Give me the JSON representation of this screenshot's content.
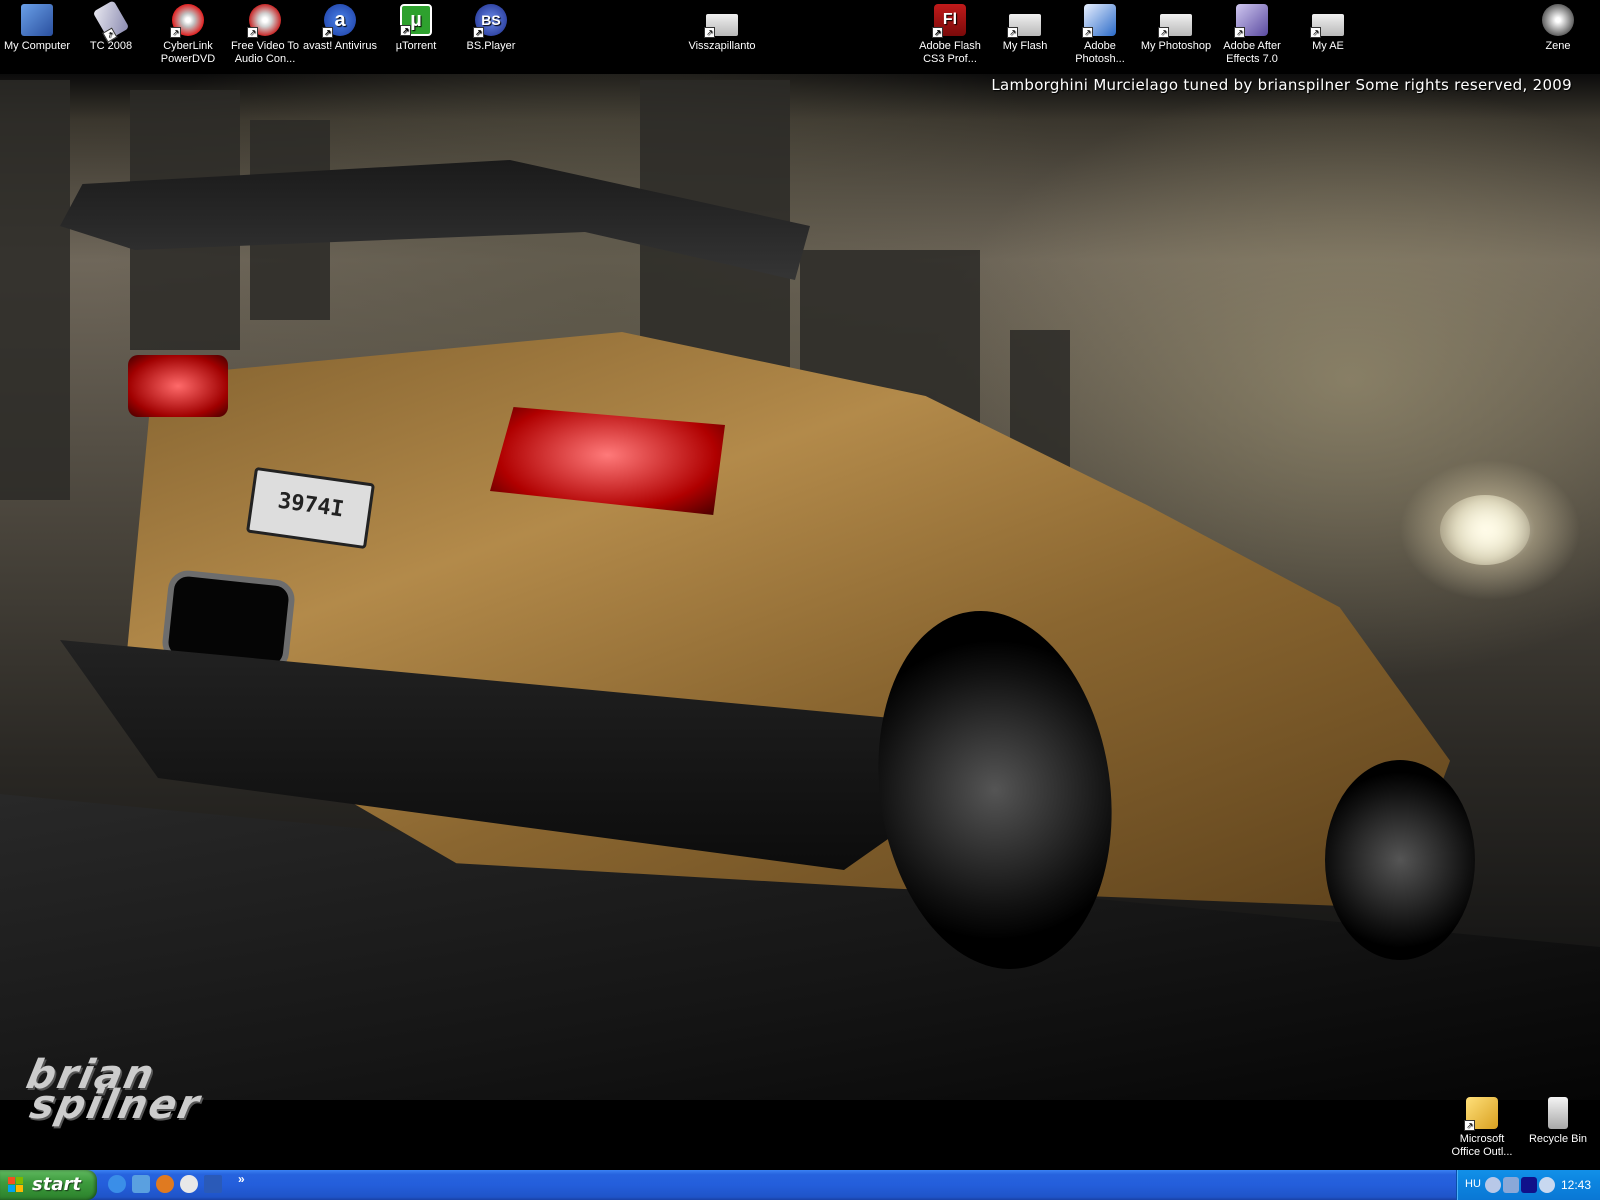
{
  "desktop": {
    "icons_top": [
      {
        "label": "My Computer",
        "icon": "computer-icon"
      },
      {
        "label": "TC 2008",
        "icon": "total-commander-icon"
      },
      {
        "label": "CyberLink PowerDVD",
        "icon": "dvd-player-icon"
      },
      {
        "label": "Free Video To Audio Con...",
        "icon": "video-converter-icon"
      },
      {
        "label": "avast! Antivirus",
        "icon": "antivirus-icon",
        "glyph": "a"
      },
      {
        "label": "µTorrent",
        "icon": "torrent-icon",
        "glyph": "µ"
      },
      {
        "label": "BS.Player",
        "icon": "media-player-icon",
        "glyph": "BS"
      },
      {
        "label": "Visszapillanto",
        "icon": "folder-icon"
      },
      {
        "label": "Adobe Flash CS3 Prof...",
        "icon": "adobe-flash-icon",
        "glyph": "Fl"
      },
      {
        "label": "My Flash",
        "icon": "folder-icon"
      },
      {
        "label": "Adobe Photosh...",
        "icon": "adobe-photoshop-icon"
      },
      {
        "label": "My Photoshop",
        "icon": "folder-icon"
      },
      {
        "label": "Adobe After Effects 7.0",
        "icon": "adobe-after-effects-icon"
      },
      {
        "label": "My AE",
        "icon": "folder-icon"
      },
      {
        "label": "Zene",
        "icon": "music-disc-icon"
      }
    ],
    "icons_bottom": [
      {
        "label": "Microsoft Office Outl...",
        "icon": "outlook-icon"
      },
      {
        "label": "Recycle Bin",
        "icon": "recycle-bin-icon"
      }
    ],
    "wallpaper": {
      "caption": "Lamborghini Murcielago tuned by brianspilner   Some rights reserved, 2009",
      "logo_line1": "brian",
      "logo_line2": "spilner",
      "plate": "3974I"
    }
  },
  "taskbar": {
    "start_label": "start",
    "quick_launch": [
      {
        "icon": "internet-explorer-icon",
        "color": "#3a8ee8"
      },
      {
        "icon": "show-desktop-icon",
        "color": "#5aa0e0"
      },
      {
        "icon": "firefox-icon",
        "color": "#e07a20"
      },
      {
        "icon": "media-player-icon",
        "color": "#e8e8e8"
      },
      {
        "icon": "word-icon",
        "color": "#2a5ab8"
      }
    ],
    "more": "»",
    "tray": {
      "language": "HU",
      "icons": [
        "back-arrow-icon",
        "network-icon",
        "play-icon",
        "antivirus-tray-icon"
      ],
      "clock": "12:43"
    }
  },
  "colors": {
    "taskbar_blue": "#245edb",
    "start_green": "#3e9c3e",
    "tray_blue": "#0c85e0"
  }
}
